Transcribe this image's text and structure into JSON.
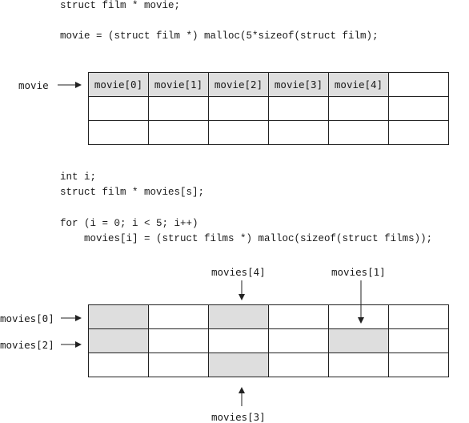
{
  "code_block_1": {
    "line_1": "struct film * movie;",
    "line_2": "movie = (struct film *) malloc(5*sizeof(struct film);"
  },
  "diagram_1": {
    "pointer_label": "movie",
    "row_1": [
      "movie[0]",
      "movie[1]",
      "movie[2]",
      "movie[3]",
      "movie[4]",
      ""
    ]
  },
  "code_block_2": {
    "line_1": "int i;",
    "line_2": "struct film * movies[s];",
    "line_3": "for (i = 0; i < 5; i++)",
    "line_4": "    movies[i] = (struct films *) malloc(sizeof(struct films));"
  },
  "diagram_2": {
    "labels": {
      "movies_0": "movies[0]",
      "movies_1": "movies[1]",
      "movies_2": "movies[2]",
      "movies_3": "movies[3]",
      "movies_4": "movies[4]"
    }
  }
}
